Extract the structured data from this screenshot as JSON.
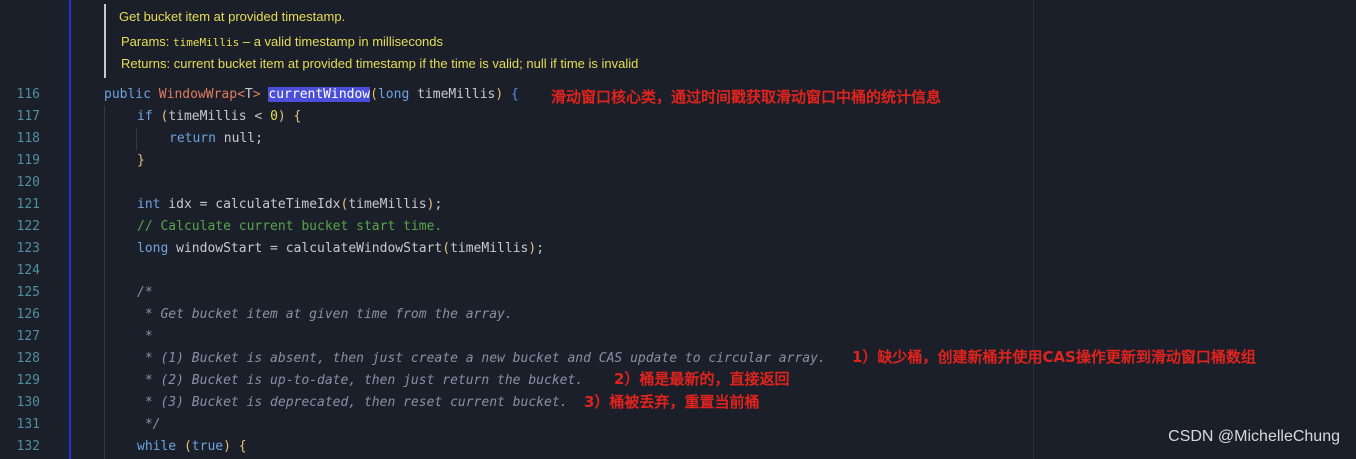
{
  "doc": {
    "summary": "Get bucket item at provided timestamp.",
    "params_label": "Params:",
    "params_code": "timeMillis",
    "params_text": " – a valid timestamp in milliseconds",
    "returns_label": "Returns:",
    "returns_text": "current bucket item at provided timestamp if the time is valid; null if time is invalid"
  },
  "line_numbers": [
    "116",
    "117",
    "118",
    "119",
    "120",
    "121",
    "122",
    "123",
    "124",
    "125",
    "126",
    "127",
    "128",
    "129",
    "130",
    "131",
    "132"
  ],
  "code": {
    "l116": {
      "kw_public": "public",
      "type": "WindowWrap",
      "lt": "<",
      "generic": "T",
      "gt": ">",
      "method": "currentWindow",
      "open": "(",
      "kw_long": "long",
      "param": " timeMillis",
      "close": ")",
      "brace": "{"
    },
    "l117": {
      "kw": "if",
      "open": "(",
      "ident": "timeMillis < ",
      "num": "0",
      "close": ")",
      "brace": "{"
    },
    "l118": {
      "kw": "return",
      "rest": " null;"
    },
    "l119": {
      "brace": "}"
    },
    "l121": {
      "kw": "int",
      "ident": " idx = calculateTimeIdx",
      "open": "(",
      "arg": "timeMillis",
      "close": ")",
      "end": ";"
    },
    "l122": {
      "comment": "// Calculate current bucket start time."
    },
    "l123": {
      "kw": "long",
      "ident": " windowStart = calculateWindowStart",
      "open": "(",
      "arg": "timeMillis",
      "close": ")",
      "end": ";"
    },
    "l125": "/*",
    "l126": " * Get bucket item at given time from the array.",
    "l127": " *",
    "l128": " * (1) Bucket is absent, then just create a new bucket and CAS update to circular array.",
    "l129": " * (2) Bucket is up-to-date, then just return the bucket.",
    "l130": " * (3) Bucket is deprecated, then reset current bucket.",
    "l131": " */",
    "l132": {
      "kw": "while",
      "open": "(",
      "kw_true": "true",
      "close": ")",
      "brace": "{"
    }
  },
  "annotations": {
    "a116": "滑动窗口核心类，通过时间戳获取滑动窗口中桶的统计信息",
    "a128": "1）缺少桶，创建新桶并使用CAS操作更新到滑动窗口桶数组",
    "a129": "2）桶是最新的，直接返回",
    "a130": "3）桶被丢弃，重置当前桶"
  },
  "watermark": "CSDN @MichelleChung",
  "colors": {
    "background": "#1b1f2a",
    "keyword": "#6ea4de",
    "type": "#e07d5f",
    "comment": "#57a64a",
    "javadoc": "#8a8fa6",
    "doc_text": "#e7dd54",
    "annotation": "#e0231c",
    "selection": "#4b4ed8"
  }
}
